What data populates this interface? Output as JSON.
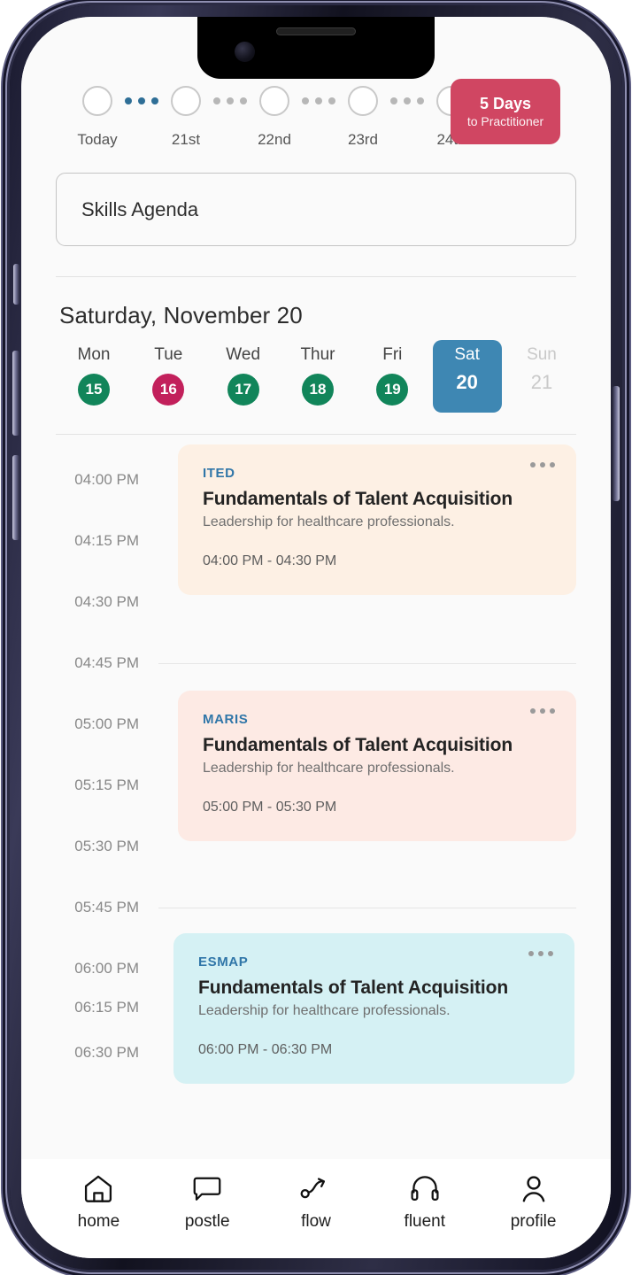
{
  "app": {
    "title": "Practitioner"
  },
  "progress": {
    "steps": [
      {
        "label": "Today",
        "connector_active": true
      },
      {
        "label": "21st",
        "connector_active": false
      },
      {
        "label": "22nd",
        "connector_active": false
      },
      {
        "label": "23rd",
        "connector_active": false
      },
      {
        "label": "24th",
        "connector_active": false
      }
    ],
    "badge": {
      "big": "5 Days",
      "small": "to Practitioner",
      "color": "#d04662"
    },
    "active_dot_color": "#2e6e96",
    "inactive_dot_color": "#b7b7b7"
  },
  "agenda_box": {
    "value": "Skills Agenda",
    "placeholder": "Skills Agenda"
  },
  "date_header": {
    "selected_date": "Saturday, November 20",
    "selected_color": "#3e87b3",
    "weekdays": [
      {
        "name": "Mon",
        "number": "15",
        "state": "dot",
        "color": "#11855a"
      },
      {
        "name": "Tue",
        "number": "16",
        "state": "dot",
        "color": "#c2205b"
      },
      {
        "name": "Wed",
        "number": "17",
        "state": "dot",
        "color": "#11855a"
      },
      {
        "name": "Thur",
        "number": "18",
        "state": "dot",
        "color": "#11855a"
      },
      {
        "name": "Fri",
        "number": "19",
        "state": "dot",
        "color": "#11855a"
      },
      {
        "name": "Sat",
        "number": "20",
        "state": "selected",
        "color": "#3e87b3"
      },
      {
        "name": "Sun",
        "number": "21",
        "state": "muted",
        "color": "#c9c9c9"
      }
    ]
  },
  "schedule": {
    "time_slots": [
      {
        "time": "04:00 PM",
        "ruled": false
      },
      {
        "time": "04:15 PM",
        "ruled": false
      },
      {
        "time": "04:30 PM",
        "ruled": false
      },
      {
        "time": "04:45 PM",
        "ruled": true
      },
      {
        "time": "05:00 PM",
        "ruled": false
      },
      {
        "time": "05:15 PM",
        "ruled": false
      },
      {
        "time": "05:30 PM",
        "ruled": false
      },
      {
        "time": "05:45 PM",
        "ruled": true
      },
      {
        "time": "06:00 PM",
        "ruled": false
      },
      {
        "time": "06:15 PM",
        "ruled": false
      },
      {
        "time": "06:30 PM",
        "ruled": false
      }
    ],
    "events": [
      {
        "tag": "ITED",
        "title": "Fundamentals of Talent Acquisition",
        "subtitle": "Leadership for healthcare professionals.",
        "time_range": "04:00 PM - 04:30 PM",
        "bg": "#fdf0e4",
        "menu": "more-options"
      },
      {
        "tag": "MARIS",
        "title": "Fundamentals of Talent Acquisition",
        "subtitle": "Leadership for healthcare professionals.",
        "time_range": "05:00 PM - 05:30 PM",
        "bg": "#fdeae4",
        "menu": "more-options"
      },
      {
        "tag": "ESMAP",
        "title": "Fundamentals of Talent Acquisition",
        "subtitle": "Leadership for healthcare professionals.",
        "time_range": "06:00 PM - 06:30 PM",
        "bg": "#d5f1f4",
        "menu": "more-options"
      }
    ]
  },
  "bottom_nav": {
    "items": [
      {
        "label": "home",
        "icon": "home-icon"
      },
      {
        "label": "postle",
        "icon": "chat-bubble-icon"
      },
      {
        "label": "flow",
        "icon": "flow-arrow-icon"
      },
      {
        "label": "fluent",
        "icon": "headphones-icon"
      },
      {
        "label": "profile",
        "icon": "person-icon"
      }
    ]
  }
}
